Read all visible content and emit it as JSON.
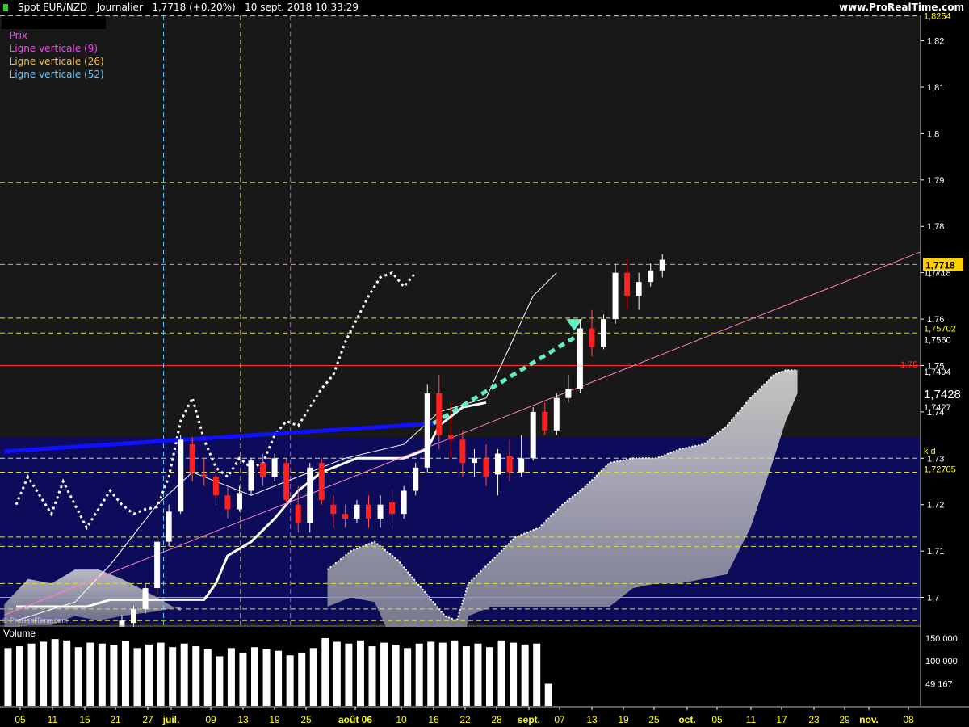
{
  "header": {
    "title": "Spot EUR/NZD   Journalier   1,7718 (+0,20%)   10 sept. 2018 10:33:29",
    "brand": "www.ProRealTime.com"
  },
  "legend": {
    "price": "Prix",
    "items": [
      {
        "label": "Ligne verticale (9)",
        "color": "#e040e0"
      },
      {
        "label": "Ligne verticale (26)",
        "color": "#f0c040"
      },
      {
        "label": "Ligne verticale (52)",
        "color": "#60c8ff"
      }
    ]
  },
  "watermark": "© ProRealTime.com",
  "volume_title": "Volume",
  "chart_data": {
    "type": "candlestick",
    "instrument": "Spot EUR/NZD",
    "ylim": [
      1.694,
      1.8255
    ],
    "y_ticks": [
      "1,82",
      "1,81",
      "1,8",
      "1,79",
      "1,78",
      "1,77",
      "1,76",
      "1,75",
      "1,74",
      "1,73",
      "1,72",
      "1,71",
      "1,7"
    ],
    "x_ticks": [
      "05",
      "11",
      "15",
      "21",
      "27",
      "juil.",
      "09",
      "13",
      "19",
      "25",
      "août 06",
      "10",
      "16",
      "22",
      "28",
      "sept.",
      "07",
      "13",
      "19",
      "25",
      "oct.",
      "05",
      "11",
      "17",
      "23",
      "29",
      "nov.",
      "08"
    ],
    "price_tags": [
      {
        "label": "1,8254",
        "value": 1.8254,
        "color": "#ffff00"
      },
      {
        "label": "1,7718",
        "value": 1.7718,
        "color": "#ffff00",
        "highlight": true
      },
      {
        "label": "1,7718",
        "value": 1.77,
        "color": "#ffffff"
      },
      {
        "label": "1,75702",
        "value": 1.758,
        "color": "#ffff00"
      },
      {
        "label": "1,7560",
        "value": 1.7556,
        "color": "#ffffff"
      },
      {
        "label": "1,75",
        "value": 1.7503,
        "color": "#ff3333"
      },
      {
        "label": "1,7494",
        "value": 1.7487,
        "color": "#ffffff"
      },
      {
        "label": "1,7428",
        "value": 1.7436,
        "color": "#ffffff",
        "large": true
      },
      {
        "label": "1,7427",
        "value": 1.741,
        "color": "#ffffff"
      },
      {
        "label": "k d",
        "value": 1.7316,
        "color": "#ffff00"
      },
      {
        "label": "1,72705",
        "value": 1.7277,
        "color": "#ffff00"
      }
    ],
    "horizontal_levels": [
      {
        "value": 1.8254,
        "color": "#e0e040",
        "style": "dash"
      },
      {
        "value": 1.7895,
        "color": "#e0e040",
        "style": "dash"
      },
      {
        "value": 1.7718,
        "color": "#ff80c0",
        "style": "dash"
      },
      {
        "value": 1.7602,
        "color": "#e0e040",
        "style": "dash"
      },
      {
        "value": 1.757,
        "color": "#e0e040",
        "style": "dash"
      },
      {
        "value": 1.75,
        "color": "#ff3030",
        "style": "solid"
      },
      {
        "value": 1.73,
        "color": "#e0e040",
        "style": "dash"
      },
      {
        "value": 1.727,
        "color": "#e0e040",
        "style": "dash"
      },
      {
        "value": 1.713,
        "color": "#e0e040",
        "style": "dash"
      },
      {
        "value": 1.711,
        "color": "#e0e040",
        "style": "dash"
      },
      {
        "value": 1.703,
        "color": "#e0e040",
        "style": "dash"
      },
      {
        "value": 1.7,
        "color": "#40e040",
        "style": "solid"
      },
      {
        "value": 1.6975,
        "color": "#e0e040",
        "style": "dash"
      },
      {
        "value": 1.695,
        "color": "#e0e040",
        "style": "dash"
      }
    ],
    "vertical_lines": [
      {
        "date_index": 4.3,
        "color": "#60c8ff"
      },
      {
        "date_index": 10.85,
        "color": "#f0c040"
      },
      {
        "date_index": 15.1,
        "color": "#e040e0"
      }
    ],
    "zone": {
      "from": 1.6945,
      "to": 1.7345
    },
    "candles": [
      [
        1.6928,
        1.6962,
        1.692,
        1.695
      ],
      [
        1.6945,
        1.6982,
        1.693,
        1.6975
      ],
      [
        1.6975,
        1.703,
        1.6965,
        1.702
      ],
      [
        1.702,
        1.713,
        1.7005,
        1.712
      ],
      [
        1.712,
        1.72,
        1.711,
        1.7185
      ],
      [
        1.7185,
        1.735,
        1.718,
        1.734
      ],
      [
        1.733,
        1.7345,
        1.725,
        1.727
      ],
      [
        1.7265,
        1.73,
        1.724,
        1.726
      ],
      [
        1.726,
        1.728,
        1.72,
        1.722
      ],
      [
        1.722,
        1.724,
        1.717,
        1.719
      ],
      [
        1.719,
        1.724,
        1.7185,
        1.7225
      ],
      [
        1.723,
        1.73,
        1.722,
        1.7295
      ],
      [
        1.729,
        1.731,
        1.724,
        1.726
      ],
      [
        1.726,
        1.731,
        1.725,
        1.73
      ],
      [
        1.729,
        1.73,
        1.72,
        1.721
      ],
      [
        1.72,
        1.724,
        1.714,
        1.716
      ],
      [
        1.716,
        1.729,
        1.714,
        1.728
      ],
      [
        1.729,
        1.73,
        1.72,
        1.721
      ],
      [
        1.72,
        1.722,
        1.715,
        1.718
      ],
      [
        1.718,
        1.72,
        1.715,
        1.717
      ],
      [
        1.717,
        1.721,
        1.716,
        1.72
      ],
      [
        1.72,
        1.722,
        1.715,
        1.717
      ],
      [
        1.717,
        1.722,
        1.715,
        1.72
      ],
      [
        1.7205,
        1.723,
        1.715,
        1.718
      ],
      [
        1.718,
        1.724,
        1.717,
        1.723
      ],
      [
        1.723,
        1.729,
        1.722,
        1.728
      ],
      [
        1.728,
        1.746,
        1.727,
        1.744
      ],
      [
        1.744,
        1.748,
        1.732,
        1.735
      ],
      [
        1.735,
        1.742,
        1.73,
        1.734
      ],
      [
        1.734,
        1.736,
        1.726,
        1.729
      ],
      [
        1.729,
        1.732,
        1.726,
        1.73
      ],
      [
        1.73,
        1.733,
        1.724,
        1.726
      ],
      [
        1.7265,
        1.732,
        1.722,
        1.731
      ],
      [
        1.7305,
        1.734,
        1.725,
        1.727
      ],
      [
        1.727,
        1.735,
        1.726,
        1.73
      ],
      [
        1.73,
        1.741,
        1.7295,
        1.74
      ],
      [
        1.74,
        1.742,
        1.735,
        1.736
      ],
      [
        1.736,
        1.744,
        1.735,
        1.743
      ],
      [
        1.743,
        1.748,
        1.742,
        1.745
      ],
      [
        1.745,
        1.76,
        1.744,
        1.758
      ],
      [
        1.758,
        1.762,
        1.752,
        1.754
      ],
      [
        1.754,
        1.761,
        1.7535,
        1.76
      ],
      [
        1.76,
        1.772,
        1.759,
        1.77
      ],
      [
        1.77,
        1.773,
        1.762,
        1.765
      ],
      [
        1.765,
        1.77,
        1.762,
        1.768
      ],
      [
        1.768,
        1.772,
        1.767,
        1.7705
      ],
      [
        1.7705,
        1.774,
        1.769,
        1.7728
      ]
    ],
    "volume": {
      "ylim": [
        0,
        175000
      ],
      "y_ticks": [
        "150 000",
        "100 000",
        "49 167"
      ],
      "values": [
        128000,
        132000,
        138000,
        142000,
        148000,
        145000,
        130000,
        140000,
        138000,
        135000,
        144000,
        128000,
        136000,
        140000,
        130000,
        138000,
        132000,
        125000,
        110000,
        128000,
        118000,
        130000,
        125000,
        122000,
        112000,
        118000,
        128000,
        150000,
        142000,
        138000,
        145000,
        132000,
        140000,
        135000,
        128000,
        138000,
        142000,
        140000,
        145000,
        132000,
        138000,
        130000,
        145000,
        140000,
        136000,
        138000,
        49167
      ]
    }
  }
}
